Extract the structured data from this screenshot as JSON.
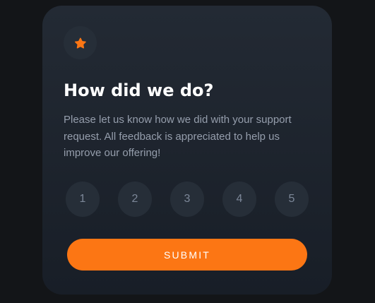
{
  "card": {
    "icon": "star-icon",
    "title": "How did we do?",
    "description": "Please let us know how we did with your support request. All feedback is appreciated to help us improve our offering!",
    "ratings": [
      "1",
      "2",
      "3",
      "4",
      "5"
    ],
    "submit_label": "SUBMIT"
  },
  "colors": {
    "background": "#131518",
    "card": "#1e252e",
    "accent": "#fc7614",
    "rating_bg": "#262e38",
    "muted_text": "#959eac"
  }
}
